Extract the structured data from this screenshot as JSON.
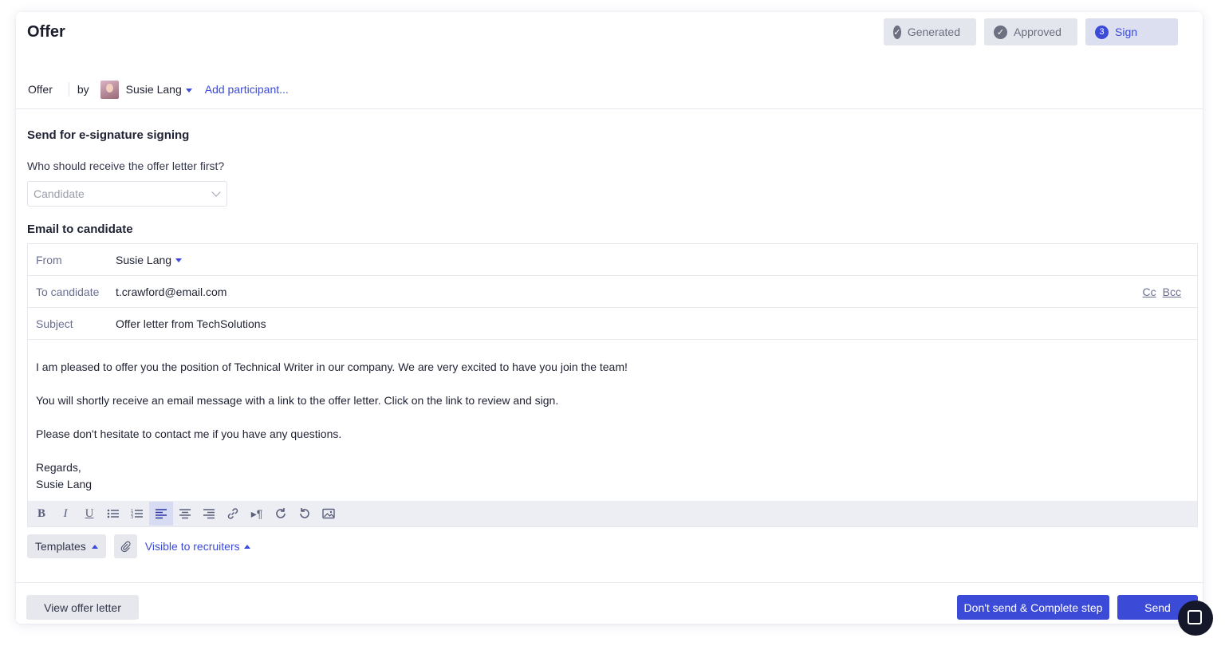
{
  "header": {
    "title": "Offer"
  },
  "steps": [
    {
      "label": "Generated",
      "state": "done"
    },
    {
      "label": "Approved",
      "state": "done"
    },
    {
      "label": "Sign",
      "number": "3",
      "state": "active"
    }
  ],
  "meta": {
    "doc": "Offer",
    "by": "by",
    "owner": "Susie Lang",
    "add_participant": "Add participant..."
  },
  "signing": {
    "heading": "Send for e-signature signing",
    "question": "Who should receive the offer letter first?",
    "recipient_placeholder": "Candidate"
  },
  "email": {
    "heading": "Email to candidate",
    "from_label": "From",
    "from_value": "Susie Lang",
    "to_label": "To candidate",
    "to_value": "t.crawford@email.com",
    "cc": "Cc",
    "bcc": "Bcc",
    "subject_label": "Subject",
    "subject_value": "Offer letter from TechSolutions",
    "body": [
      "I am pleased to offer you the position of Technical Writer in our company. We are very excited to have you join the team!",
      "You will shortly receive an email message with a link to the offer letter. Click on the link to review and sign.",
      "Please don't hesitate to contact me if you have any questions.",
      "Regards,",
      "Susie Lang"
    ]
  },
  "toolbar": {
    "buttons": [
      "bold-icon",
      "italic-icon",
      "underline-icon",
      "bullet-list-icon",
      "numbered-list-icon",
      "align-left-icon",
      "align-center-icon",
      "align-right-icon",
      "link-icon",
      "text-direction-icon",
      "redo-icon",
      "undo-icon",
      "image-icon"
    ],
    "active": "align-left-icon"
  },
  "tools": {
    "templates": "Templates",
    "visibility": "Visible to recruiters"
  },
  "footer": {
    "view": "View offer letter",
    "complete": "Don't send & Complete step",
    "send": "Send"
  },
  "colors": {
    "accent": "#3c4ad8",
    "step_bg": "#e4e6ee",
    "toolbar_bg": "#eceef4"
  }
}
